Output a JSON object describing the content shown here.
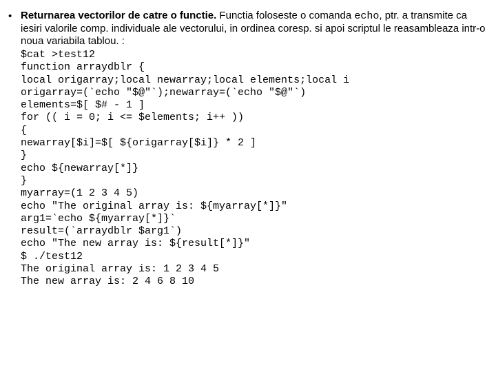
{
  "bullet": {
    "marker": "•",
    "title": "Returnarea vectorilor de catre o functie.",
    "sentence_part1": " Functia foloseste o comanda ",
    "mono_word": "echo",
    "sentence_part2": ", ptr. a transmite ca iesiri valorile comp. individuale ale vectorului, in ordinea coresp.  si apoi scriptul le reasambleaza intr-o noua variabila tablou. :"
  },
  "code": "$cat >test12\nfunction arraydblr {\nlocal origarray;local newarray;local elements;local i\norigarray=(`echo \"$@\"`);newarray=(`echo \"$@\"`)\nelements=$[ $# - 1 ]\nfor (( i = 0; i <= $elements; i++ ))\n{\nnewarray[$i]=$[ ${origarray[$i]} * 2 ]\n}\necho ${newarray[*]}\n}\nmyarray=(1 2 3 4 5)\necho \"The original array is: ${myarray[*]}\"\narg1=`echo ${myarray[*]}`\nresult=(`arraydblr $arg1`)\necho \"The new array is: ${result[*]}\"\n$ ./test12\nThe original array is: 1 2 3 4 5\nThe new array is: 2 4 6 8 10"
}
